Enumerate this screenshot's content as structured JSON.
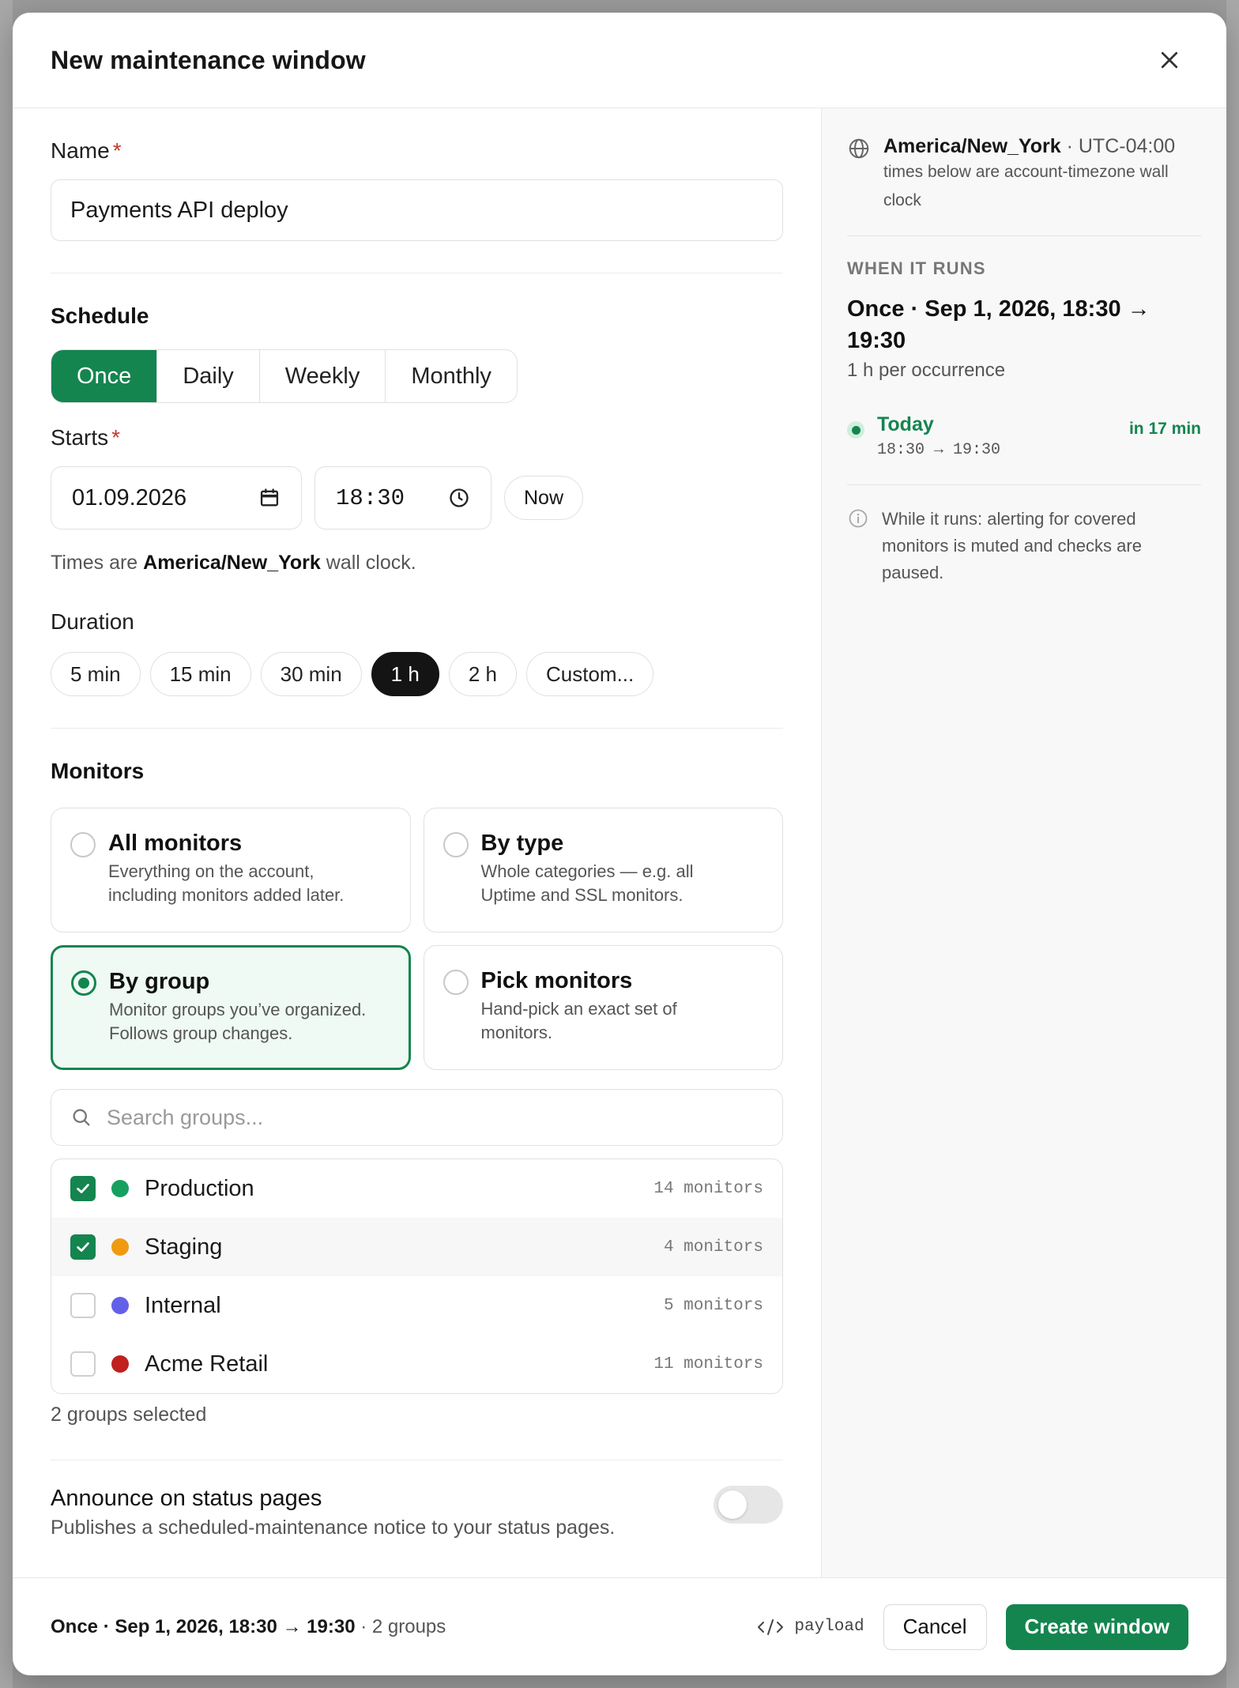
{
  "modal": {
    "title": "New maintenance window"
  },
  "name": {
    "label": "Name",
    "required_mark": "*",
    "value": "Payments API deploy"
  },
  "schedule": {
    "heading": "Schedule",
    "options": [
      "Once",
      "Daily",
      "Weekly",
      "Monthly"
    ],
    "selected": "Once"
  },
  "starts": {
    "label": "Starts",
    "required_mark": "*",
    "date": "01.09.2026",
    "time": "18:30",
    "now_label": "Now",
    "tz_note_prefix": "Times are ",
    "tz_name": "America/New_York",
    "tz_note_suffix": " wall clock."
  },
  "duration": {
    "label": "Duration",
    "options": [
      "5 min",
      "15 min",
      "30 min",
      "1 h",
      "2 h",
      "Custom..."
    ],
    "selected": "1 h"
  },
  "monitors": {
    "heading": "Monitors",
    "cards": [
      {
        "title": "All monitors",
        "desc1": "Everything on the account,",
        "desc2": "including monitors added later.",
        "selected": false
      },
      {
        "title": "By type",
        "desc1": "Whole categories — e.g. all",
        "desc2": "Uptime and SSL monitors.",
        "selected": false
      },
      {
        "title": "By group",
        "desc1": "Monitor groups you’ve organized.",
        "desc2": "Follows group changes.",
        "selected": true
      },
      {
        "title": "Pick monitors",
        "desc1": "Hand-pick an exact set of",
        "desc2": "monitors.",
        "selected": false
      }
    ],
    "search_placeholder": "Search groups...",
    "groups": [
      {
        "name": "Production",
        "count": "14 monitors",
        "color": "#16a060",
        "checked": true
      },
      {
        "name": "Staging",
        "count": "4 monitors",
        "color": "#f09a12",
        "checked": true
      },
      {
        "name": "Internal",
        "count": "5 monitors",
        "color": "#6360e8",
        "checked": false
      },
      {
        "name": "Acme Retail",
        "count": "11 monitors",
        "color": "#c0201f",
        "checked": false
      }
    ],
    "selected_summary": "2 groups selected"
  },
  "announce": {
    "title": "Announce on status pages",
    "desc": "Publishes a scheduled-maintenance notice to your status pages.",
    "enabled": false
  },
  "sidebar": {
    "tz_name": "America/New_York",
    "tz_offset": " · UTC-04:00",
    "tz_note_line1": "times below are account-timezone wall",
    "tz_note_line2": "clock",
    "when_heading": "WHEN IT RUNS",
    "when_line1": "Once · Sep 1, 2026, 18:30 →",
    "when_line2": "19:30",
    "per_occurrence": "1 h per occurrence",
    "occurrence_label": "Today",
    "occurrence_range": "18:30 → 19:30",
    "occurrence_eta": "in 17 min",
    "info_line1": "While it runs: alerting for covered",
    "info_line2": "monitors is muted and checks are",
    "info_line3": "paused."
  },
  "footer": {
    "summary_bold": "Once · Sep 1, 2026, 18:30 → 19:30",
    "summary_rest": " · 2 groups",
    "payload_label": "payload",
    "cancel_label": "Cancel",
    "create_label": "Create window"
  },
  "colors": {
    "accent": "#14854f",
    "dark_pill": "#141414",
    "required": "#c0392b"
  }
}
